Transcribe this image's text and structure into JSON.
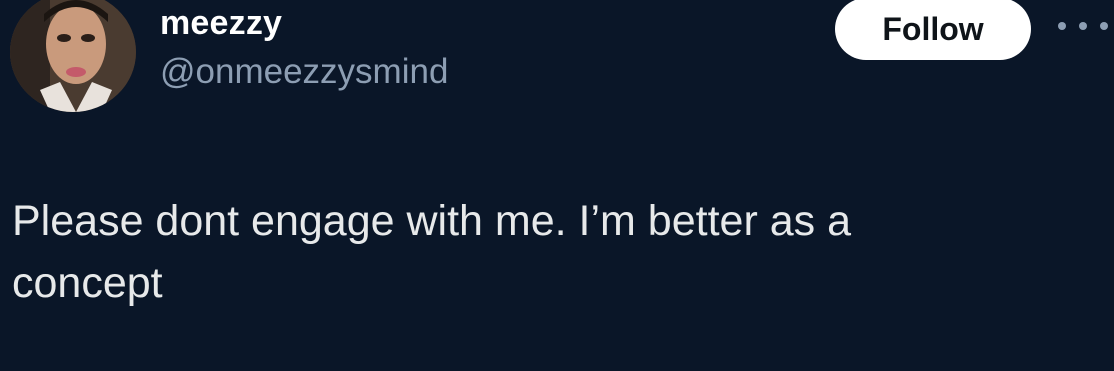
{
  "author": {
    "display_name": "meezzy",
    "handle": "@onmeezzysmind",
    "avatar_alt": "profile-photo"
  },
  "actions": {
    "follow_label": "Follow",
    "more_icon": "more-horizontal-icon"
  },
  "tweet": {
    "text": "Please dont engage with me. I’m better as a concept"
  },
  "colors": {
    "background": "#0a1628",
    "name": "#ffffff",
    "handle": "#8d9eb3",
    "text": "#e7e9ea",
    "follow_bg": "#ffffff",
    "follow_text": "#0f1419"
  }
}
